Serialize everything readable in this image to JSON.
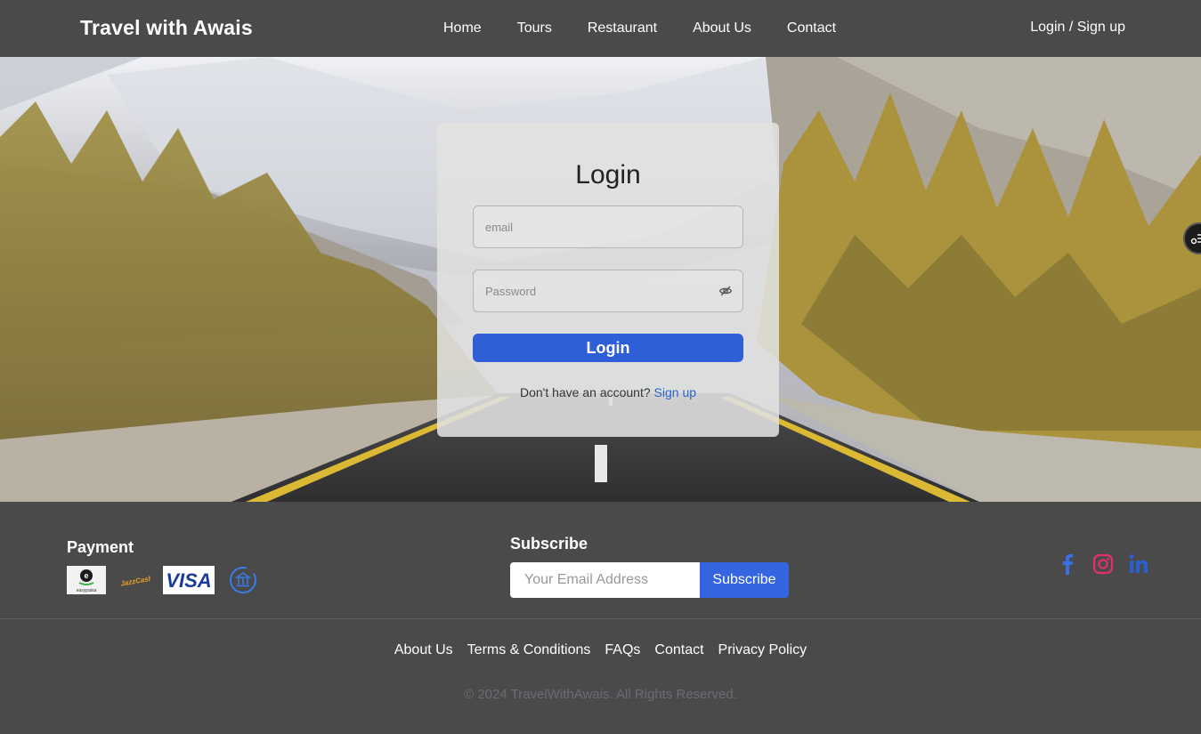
{
  "navbar": {
    "brand": "Travel with Awais",
    "links": [
      "Home",
      "Tours",
      "Restaurant",
      "About Us",
      "Contact"
    ],
    "auth": "Login / Sign up"
  },
  "login": {
    "title": "Login",
    "email_placeholder": "email",
    "password_placeholder": "Password",
    "button": "Login",
    "signup_prompt": "Don't have an account?",
    "signup_link": "Sign up"
  },
  "footer": {
    "payment_title": "Payment",
    "payment_methods": [
      "easypaisa",
      "JazzCash",
      "VISA",
      "bank-icon"
    ],
    "subscribe_title": "Subscribe",
    "subscribe_placeholder": "Your Email Address",
    "subscribe_button": "Subscribe",
    "social": [
      "facebook-icon",
      "instagram-icon",
      "linkedin-icon"
    ],
    "links": [
      "About Us",
      "Terms & Conditions",
      "FAQs",
      "Contact",
      "Privacy Policy"
    ],
    "copyright": "© 2024 TravelWithAwais. All Rights Reserved."
  },
  "colors": {
    "nav_bg": "#4a4a4b",
    "accent": "#2f5fd6",
    "link": "#2a63c9",
    "facebook": "#3b6fe8",
    "instagram": "#e1306c",
    "linkedin": "#2a5fd0"
  }
}
